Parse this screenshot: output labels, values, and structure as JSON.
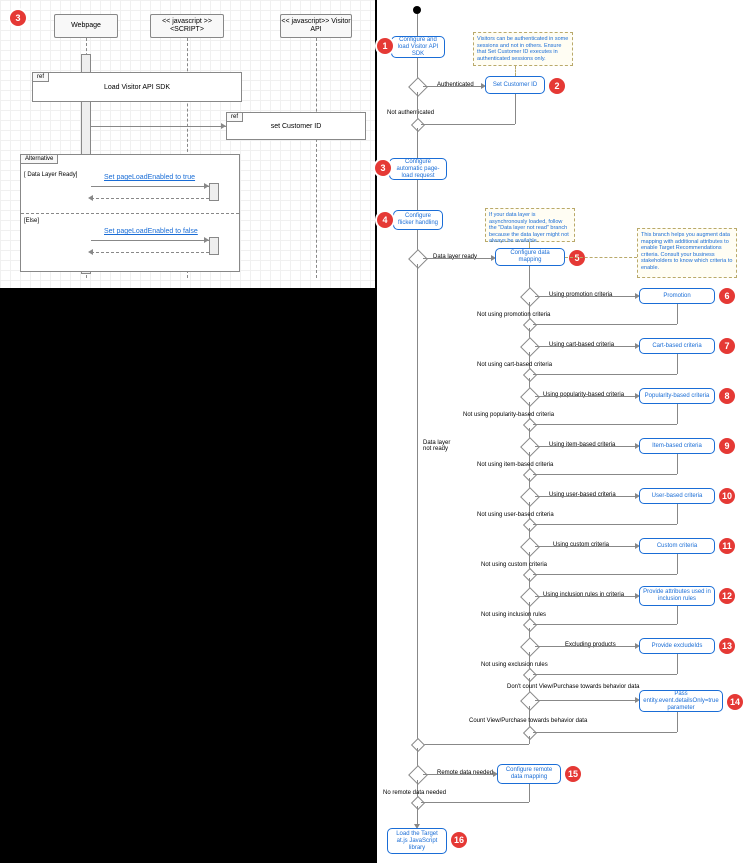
{
  "seq": {
    "lifelines": {
      "webpage": "Webpage",
      "script": "<< javascript >>\n<SCRIPT>",
      "visitor": "<< javascript>>\nVisitor API"
    },
    "ref1": "ref",
    "ref1_title": "Load Visitor API SDK",
    "ref2": "ref",
    "ref2_title": "set Customer ID",
    "alt_label": "Alternative",
    "guard_ready": "[ Data Layer Ready]",
    "guard_else": "[Else]",
    "msg_true": "Set pageLoadEnabled to true",
    "msg_false": "Set pageLoadEnabled to false"
  },
  "flow": {
    "n1": "Configure and load\nVisitor API SDK",
    "n2": "Set Customer ID",
    "n3": "Configure automatic\npage-load request",
    "n4": "Configure\nflicker handling",
    "n5": "Configure data mapping",
    "n6": "Promotion",
    "n7": "Cart-based criteria",
    "n8": "Popularity-based criteria",
    "n9": "Item-based criteria",
    "n10": "User-based criteria",
    "n11": "Custom criteria",
    "n12": "Provide attributes\nused in inclusion rules",
    "n13": "Provide excludeIds",
    "n14": "Pass\nentity.event.detailsOnly=true\nparameter",
    "n15": "Configure remote\ndata mapping",
    "n16": "Load the Target\nat.js JavaScript\nlibrary",
    "labels": {
      "auth": "Authenticated",
      "not_auth": "Not authenticated",
      "dlr": "Data layer ready",
      "dlnr": "Data layer\nnot ready",
      "up": "Using promotion criteria",
      "nup": "Not using promotion criteria",
      "uc": "Using cart-based criteria",
      "nuc": "Not using cart-based criteria",
      "upb": "Using popularity-based criteria",
      "nupb": "Not using popularity-based criteria",
      "uib": "Using item-based criteria",
      "nuib": "Not using item-based criteria",
      "uub": "Using user-based criteria",
      "nuub": "Not using user-based criteria",
      "ucc": "Using custom criteria",
      "nucc": "Not using custom criteria",
      "uir": "Using inclusion rules in criteria",
      "nuir": "Not using inclusion rules",
      "ep": "Excluding products",
      "nuer": "Not using exclusion rules",
      "dc": "Don't count View/Purchase towards behavior data",
      "cc": "Count View/Purchase towards behavior data",
      "rdn": "Remote data needed",
      "nrdn": "No remote data needed"
    },
    "notes": {
      "a": "Visitors can be authenticated in some sessions and not in others. Ensure that Set Customer ID executes in authenticated sessions only.",
      "b": "If your data layer is asynchronously loaded, follow the \"Data layer not read\" branch because the data layer might not always be available.",
      "c": "This branch helps you augment data mapping with additional attributes to enable Target Recommendations criteria. Consult your business stakeholders to know which criteria to enable."
    }
  },
  "badges": {
    "seq": "3",
    "b1": "1",
    "b2": "2",
    "b3": "3",
    "b4": "4",
    "b5": "5",
    "b6": "6",
    "b7": "7",
    "b8": "8",
    "b9": "9",
    "b10": "10",
    "b11": "11",
    "b12": "12",
    "b13": "13",
    "b14": "14",
    "b15": "15",
    "b16": "16"
  }
}
